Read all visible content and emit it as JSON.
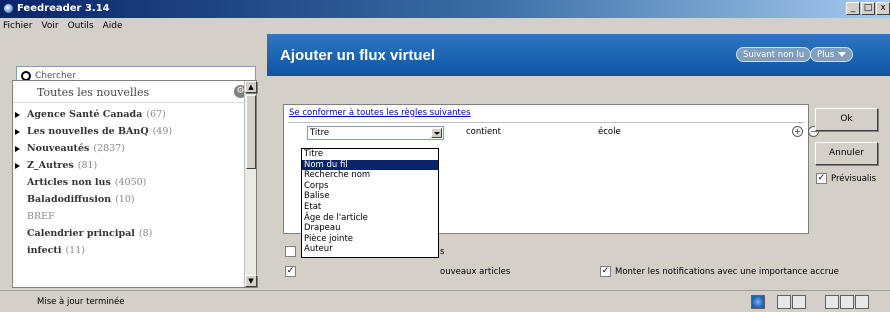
{
  "window": {
    "title": "Feedreader 3.14",
    "controls": [
      "_",
      "□",
      "x"
    ]
  },
  "menu": [
    "Fichier",
    "Voir",
    "Outils",
    "Aide"
  ],
  "search": {
    "placeholder": "Chercher"
  },
  "feeds": {
    "header": "Toutes les nouvelles",
    "items": [
      {
        "name": "Agence Santé Canada",
        "count": "(67)",
        "expandable": true
      },
      {
        "name": "Les nouvelles de BAnQ",
        "count": "(49)",
        "expandable": true
      },
      {
        "name": "Nouveautés",
        "count": "(2837)",
        "expandable": true
      },
      {
        "name": "Z_Autres",
        "count": "(81)",
        "expandable": true
      },
      {
        "name": "Articles non lus",
        "count": "(4050)",
        "expandable": false
      },
      {
        "name": "Baladodiffusion",
        "count": "(10)",
        "expandable": false
      },
      {
        "name": "BREF",
        "count": "",
        "expandable": false
      },
      {
        "name": "Calendrier principal",
        "count": "(8)",
        "expandable": false
      },
      {
        "name": "infecti",
        "count": "(11)",
        "expandable": false
      }
    ]
  },
  "dialog": {
    "title": "Ajouter un flux virtuel",
    "next_unread": "Suivant non lu",
    "more": "Plus",
    "rule_link": "Se conformer à toutes les règles suivantes",
    "rule": {
      "field": "Titre",
      "operator": "contient",
      "value": "école"
    },
    "field_options": [
      "Titre",
      "Nom du fil",
      "Recherche nom",
      "Corps",
      "Balise",
      "Etat",
      "Âge de l'article",
      "Drapeau",
      "Pièce jointe",
      "Auteur"
    ],
    "selected_option": "Nom du fil",
    "ok": "Ok",
    "cancel": "Annuler",
    "preview_label": "Prévisualis",
    "options": {
      "opt1_label": "s",
      "opt2_label": "ouveaux articles",
      "notify_label": "Monter les notifications avec une importance accrue"
    }
  },
  "status": {
    "message": "Mise à jour terminée"
  }
}
